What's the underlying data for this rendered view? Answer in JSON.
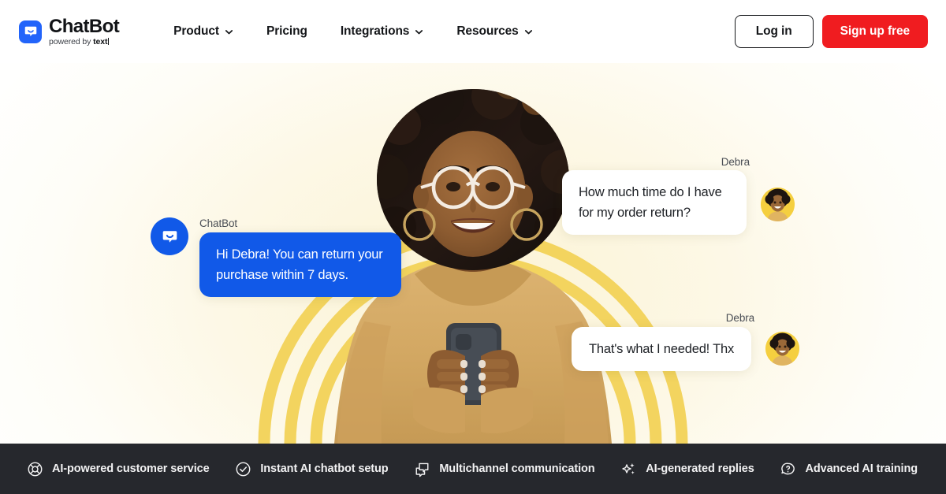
{
  "header": {
    "logo": {
      "name": "ChatBot",
      "tagline_prefix": "powered by ",
      "tagline_brand": "text",
      "icon": "chat-bubble-icon",
      "color": "#2264fa"
    },
    "nav": [
      {
        "label": "Product",
        "has_dropdown": true,
        "icon": "chevron-down-icon"
      },
      {
        "label": "Pricing",
        "has_dropdown": false
      },
      {
        "label": "Integrations",
        "has_dropdown": true,
        "icon": "chevron-down-icon"
      },
      {
        "label": "Resources",
        "has_dropdown": true,
        "icon": "chevron-down-icon"
      }
    ],
    "login_label": "Log in",
    "signup_label": "Sign up free",
    "signup_color": "#f01c20"
  },
  "hero": {
    "background_color": "#fdf8e6",
    "arc_color": "#f3d458",
    "messages": [
      {
        "sender": "Debra",
        "text": "How much time do I have for my order return?",
        "type": "user",
        "avatar": "debra-avatar"
      },
      {
        "sender": "ChatBot",
        "text": "Hi Debra! You can return your purchase within 7 days.",
        "type": "bot",
        "avatar": "chatbot-avatar",
        "bubble_color": "#1159e8"
      },
      {
        "sender": "Debra",
        "text": "That's what I needed! Thx",
        "type": "user",
        "avatar": "debra-avatar"
      }
    ]
  },
  "feature_bar": {
    "background_color": "#26282d",
    "items": [
      {
        "label": "AI-powered customer service",
        "icon": "lifebuoy-icon"
      },
      {
        "label": "Instant AI chatbot setup",
        "icon": "check-circle-icon"
      },
      {
        "label": "Multichannel communication",
        "icon": "multi-chat-icon"
      },
      {
        "label": "AI-generated replies",
        "icon": "sparkles-icon"
      },
      {
        "label": "Advanced AI training",
        "icon": "chat-question-icon"
      }
    ]
  }
}
